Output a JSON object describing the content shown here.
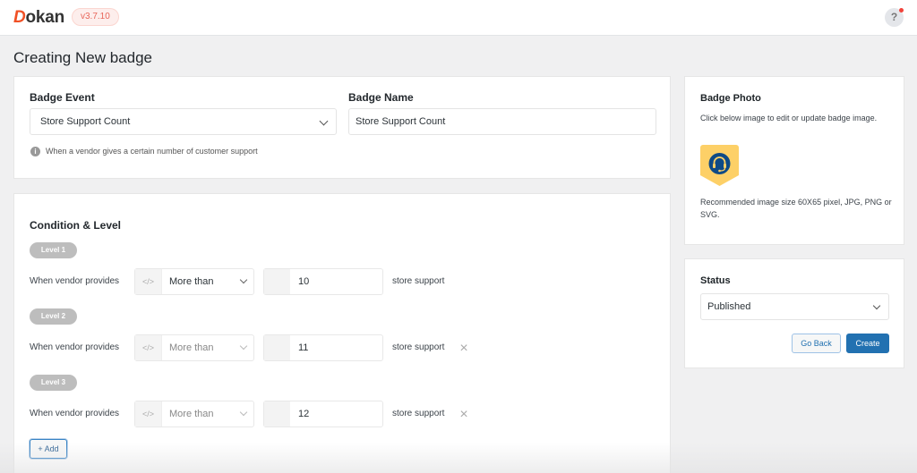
{
  "header": {
    "logo_initial": "D",
    "logo_rest": "okan",
    "version": "v3.7.10",
    "help_label": "?"
  },
  "page": {
    "title": "Creating New badge"
  },
  "badge_event": {
    "label": "Badge Event",
    "selected": "Store Support Count",
    "hint": "When a vendor gives a certain number of customer support",
    "info_icon": "i"
  },
  "badge_name": {
    "label": "Badge Name",
    "value": "Store Support Count"
  },
  "conditions": {
    "title": "Condition & Level",
    "code_icon": "</>",
    "levels": [
      {
        "pill": "Level 1",
        "prefix": "When vendor provides",
        "operator": "More than",
        "value": "10",
        "unit": "store support",
        "removable": false
      },
      {
        "pill": "Level 2",
        "prefix": "When vendor provides",
        "operator": "More than",
        "value": "11",
        "unit": "store support",
        "removable": true
      },
      {
        "pill": "Level 3",
        "prefix": "When vendor provides",
        "operator": "More than",
        "value": "12",
        "unit": "store support",
        "removable": true
      }
    ],
    "remove_icon": "×",
    "add_label": "+ Add"
  },
  "badge_photo": {
    "title": "Badge Photo",
    "description": "Click below image to edit or update badge image.",
    "recommendation": "Recommended image size 60X65 pixel, JPG, PNG or SVG.",
    "colors": {
      "shield": "#fdd067",
      "circle": "#0e4a86",
      "icon": "#fdd067"
    }
  },
  "status": {
    "title": "Status",
    "selected": "Published",
    "go_back_label": "Go Back",
    "create_label": "Create"
  }
}
